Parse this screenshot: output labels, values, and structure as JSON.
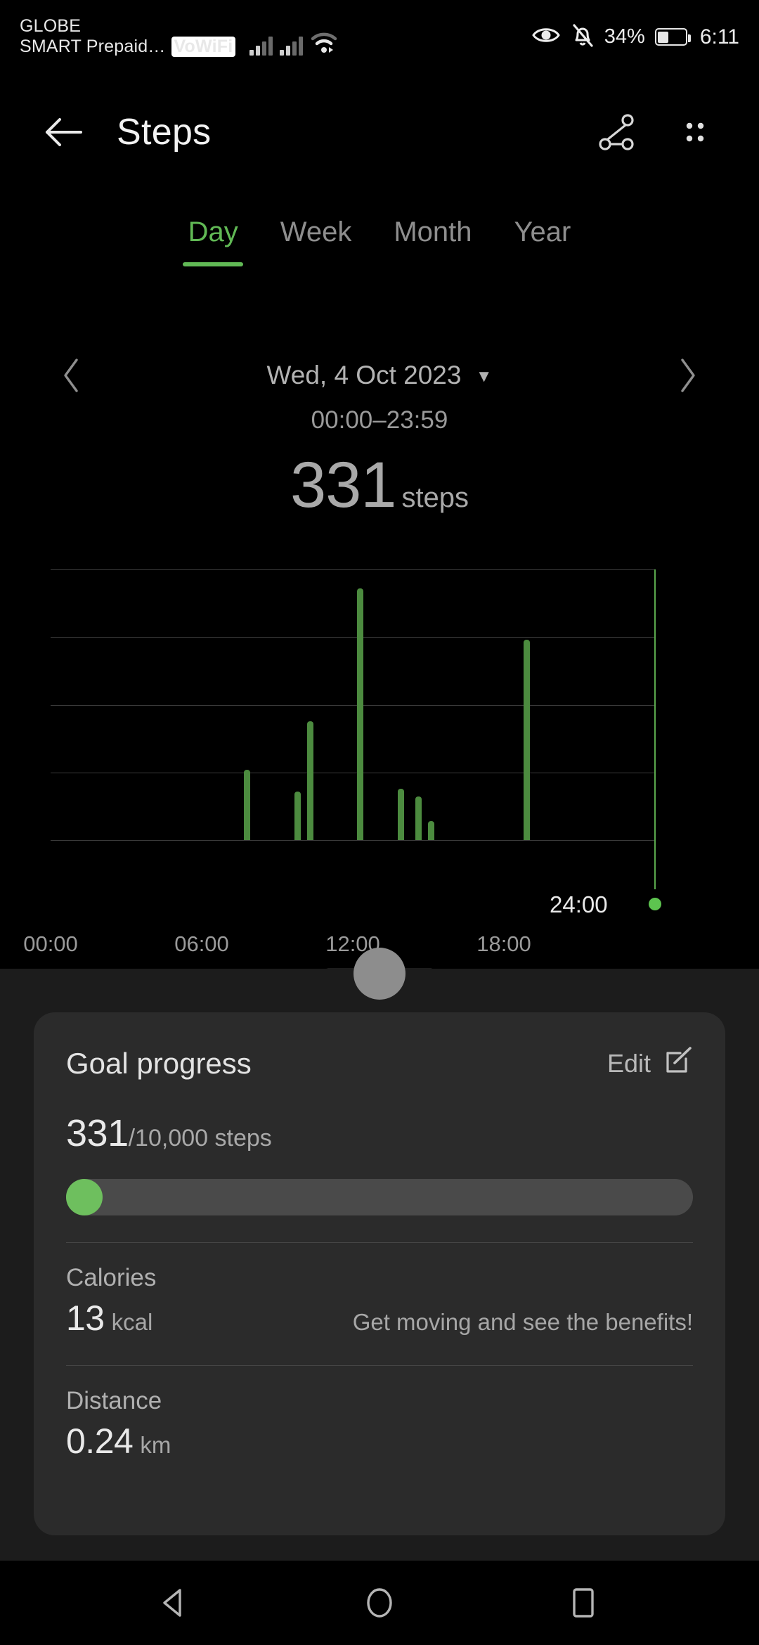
{
  "status_bar": {
    "carrier_line1": "GLOBE",
    "carrier_line2": "SMART Prepaid…",
    "vowifi_badge": "VoWiFi",
    "battery_percent": "34%",
    "clock": "6:11",
    "icons": [
      "eye-icon",
      "bell-muted-icon",
      "signal-bars-icon",
      "wifi-icon",
      "battery-icon"
    ]
  },
  "app_bar": {
    "title": "Steps",
    "back_icon": "back-arrow-icon",
    "share_icon": "share-icon",
    "more_icon": "more-grid-icon"
  },
  "tabs": {
    "items": [
      {
        "label": "Day",
        "active": true
      },
      {
        "label": "Week",
        "active": false
      },
      {
        "label": "Month",
        "active": false
      },
      {
        "label": "Year",
        "active": false
      }
    ],
    "accent_color": "#61b955"
  },
  "date_nav": {
    "prev_icon": "chevron-left-icon",
    "next_icon": "chevron-right-icon",
    "date": "Wed, 4 Oct 2023",
    "caret_icon": "caret-down-icon"
  },
  "summary": {
    "time_range": "00:00–23:59",
    "count": "331",
    "unit": "steps"
  },
  "chart_data": {
    "type": "bar",
    "title": "",
    "xlabel": "",
    "ylabel": "",
    "ylim": [
      0,
      100
    ],
    "yticks": [
      0,
      25,
      50,
      75,
      100
    ],
    "ytick_labels": [
      "0",
      "25",
      "50",
      "75",
      "100"
    ],
    "xlim": [
      0,
      24
    ],
    "xticks": [
      0,
      6,
      12,
      18
    ],
    "xtick_labels": [
      "00:00",
      "06:00",
      "12:00",
      "18:00"
    ],
    "grid": true,
    "legend": null,
    "bar_color": "#4c8b3f",
    "marker_label": "24:00",
    "marker_x": 24,
    "x": [
      7.8,
      9.8,
      10.3,
      12.3,
      13.9,
      14.6,
      15.1,
      18.9
    ],
    "values": [
      26,
      18,
      44,
      93,
      19,
      16,
      7,
      74
    ],
    "categories": [
      "07:48",
      "09:48",
      "10:18",
      "12:18",
      "13:54",
      "14:36",
      "15:06",
      "18:54"
    ]
  },
  "panel": {
    "goal_card": {
      "title": "Goal progress",
      "edit_label": "Edit",
      "edit_icon": "edit-pencil-icon",
      "current": "331",
      "target_suffix": "/10,000 steps",
      "progress_percent": 3.31,
      "progress_color": "#6ebf5e"
    },
    "metrics": [
      {
        "label": "Calories",
        "value": "13",
        "unit": "kcal",
        "hint": "Get moving and see the benefits!"
      },
      {
        "label": "Distance",
        "value": "0.24",
        "unit": "km",
        "hint": ""
      }
    ]
  },
  "nav_bar": {
    "back_icon": "nav-back-triangle-icon",
    "home_icon": "nav-home-circle-icon",
    "recents_icon": "nav-recents-square-icon"
  }
}
